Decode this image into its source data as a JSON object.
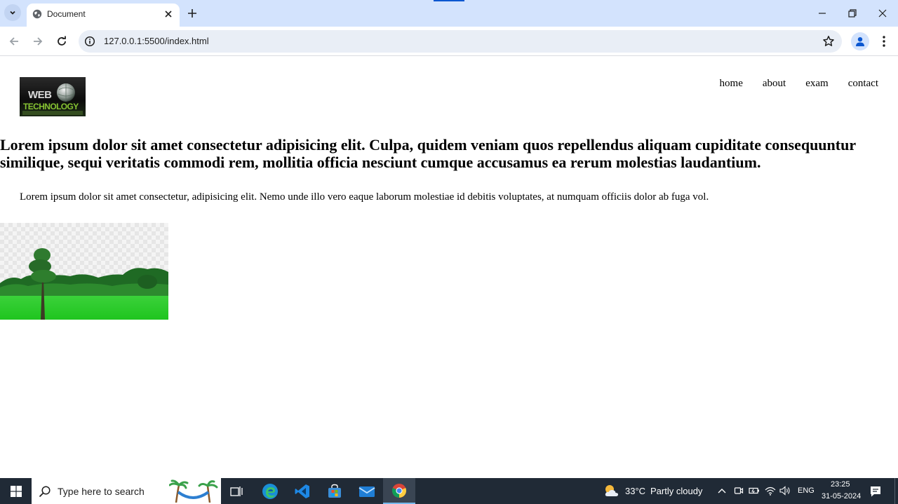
{
  "browser": {
    "tab": {
      "title": "Document"
    },
    "address_bar": {
      "url": "127.0.0.1:5500/index.html"
    },
    "accent_color": "#0b57d0",
    "tabstrip_color": "#d3e3fd"
  },
  "page": {
    "logo": {
      "alt": "WEB TECHNOLOGY",
      "line1": "WEB",
      "line2": "TECHNOLOGY"
    },
    "nav": [
      {
        "label": "home"
      },
      {
        "label": "about"
      },
      {
        "label": "exam"
      },
      {
        "label": "contact"
      }
    ],
    "heading": "Lorem ipsum dolor sit amet consectetur adipisicing elit. Culpa, quidem veniam quos repellendus aliquam cupiditate consequuntur similique, sequi veritatis commodi rem, mollitia officia nesciunt cumque accusamus ea rerum molestias laudantium.",
    "paragraph": "Lorem ipsum dolor sit amet consectetur, adipisicing elit. Nemo unde illo vero eaque laborum molestiae id debitis voluptates, at numquam officiis dolor ab fuga vol.",
    "image": {
      "icon": "landscape-tree-image"
    }
  },
  "taskbar": {
    "search_placeholder": "Type here to search",
    "apps": [
      {
        "name": "task-view"
      },
      {
        "name": "edge"
      },
      {
        "name": "vscode"
      },
      {
        "name": "store"
      },
      {
        "name": "mail"
      },
      {
        "name": "chrome",
        "active": true
      }
    ],
    "weather": {
      "temp": "33°C",
      "condition": "Partly cloudy"
    },
    "language": "ENG",
    "clock": {
      "time": "23:25",
      "date": "31-05-2024"
    },
    "background_color": "#202a36"
  }
}
